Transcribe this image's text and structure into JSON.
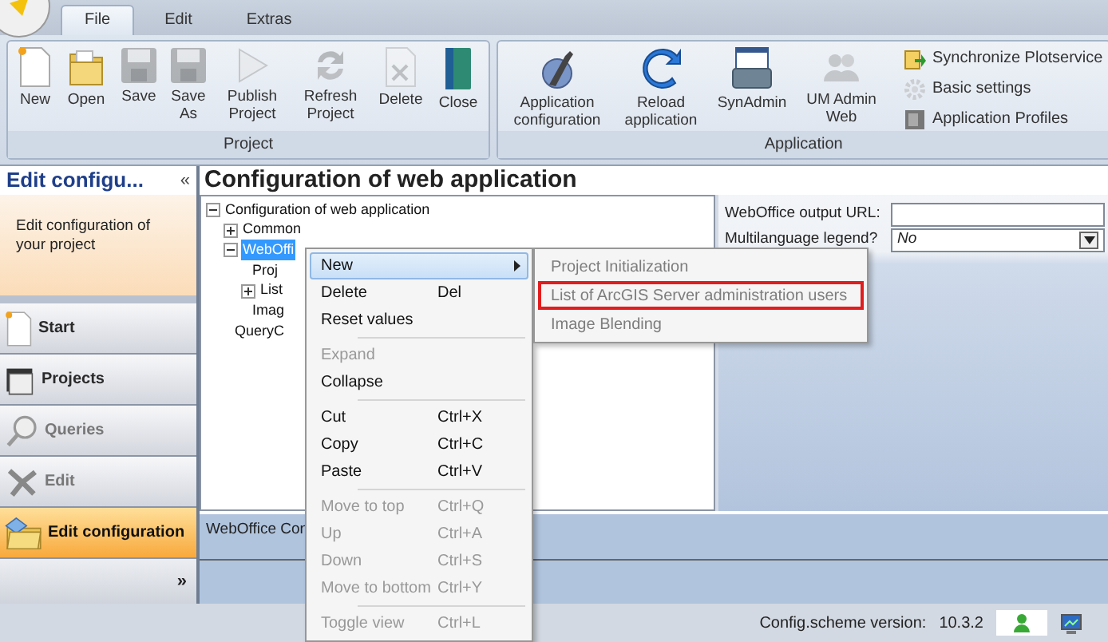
{
  "app_tabs": [
    {
      "label": "File",
      "selected": true
    },
    {
      "label": "Edit",
      "selected": false
    },
    {
      "label": "Extras",
      "selected": false
    }
  ],
  "ribbon": [
    {
      "label": "Project",
      "buttons": [
        {
          "label": "New",
          "disabled": false
        },
        {
          "label": "Open",
          "disabled": false
        },
        {
          "label": "Save",
          "disabled": true
        },
        {
          "label": "Save As",
          "disabled": true
        },
        {
          "label": "Publish Project",
          "disabled": true
        },
        {
          "label": "Refresh Project",
          "disabled": true
        },
        {
          "label": "Delete",
          "disabled": true
        },
        {
          "label": "Close",
          "disabled": false
        }
      ]
    },
    {
      "label": "Application",
      "buttons": [
        {
          "label": "Application configuration",
          "disabled": false
        },
        {
          "label": "Reload application",
          "disabled": false
        },
        {
          "label": "SynAdmin",
          "disabled": false
        },
        {
          "label": "UM Admin Web",
          "disabled": true
        }
      ],
      "small_buttons": [
        {
          "label": "Synchronize Plotservice",
          "disabled": false
        },
        {
          "label": "Basic settings",
          "disabled": true
        },
        {
          "label": "Application Profiles",
          "disabled": false
        }
      ]
    }
  ],
  "sidebar": {
    "title": "Edit  configu...",
    "collapse_glyph": "«",
    "description": "Edit configuration of your project",
    "items": [
      {
        "label": "Start",
        "disabled": false,
        "selected": false
      },
      {
        "label": "Projects",
        "disabled": false,
        "selected": false
      },
      {
        "label": "Queries",
        "disabled": true,
        "selected": false
      },
      {
        "label": "Edit",
        "disabled": true,
        "selected": false
      },
      {
        "label": "Edit configuration",
        "disabled": false,
        "selected": true
      }
    ],
    "more_glyph": "»"
  },
  "title": "Configuration of web application",
  "tree": [
    {
      "label": "Configuration of web application",
      "expanded": true,
      "selected": false,
      "children": [
        {
          "label": "Common",
          "expanded": false,
          "selected": false
        },
        {
          "label": "WebOffi",
          "expanded": true,
          "selected": true,
          "children": [
            {
              "label": "Proj",
              "selected": false
            },
            {
              "label": "List",
              "expanded": false,
              "selected": false
            },
            {
              "label": "Imag",
              "selected": false
            }
          ]
        },
        {
          "label": "QueryC",
          "selected": false
        }
      ]
    }
  ],
  "properties": [
    {
      "label": "WebOffice output URL:",
      "kind": "text"
    },
    {
      "label": "Multilanguage legend?",
      "kind": "select",
      "value": "No"
    }
  ],
  "bottom_panel": {
    "text": "WebOffice Con"
  },
  "context_menu": {
    "groups": [
      [
        {
          "label": "New",
          "has_submenu": true,
          "disabled": false,
          "selected": true
        },
        {
          "label": "Delete",
          "shortcut": "Del",
          "disabled": false,
          "selected": false
        },
        {
          "label": "Reset values",
          "disabled": false,
          "selected": false
        }
      ],
      [
        {
          "label": "Expand",
          "disabled": true,
          "selected": false
        },
        {
          "label": "Collapse",
          "disabled": false,
          "selected": false
        }
      ],
      [
        {
          "label": "Cut",
          "shortcut": "Ctrl+X",
          "disabled": false,
          "selected": false
        },
        {
          "label": "Copy",
          "shortcut": "Ctrl+C",
          "disabled": false,
          "selected": false
        },
        {
          "label": "Paste",
          "shortcut": "Ctrl+V",
          "disabled": false,
          "selected": false
        }
      ],
      [
        {
          "label": "Move to top",
          "shortcut": "Ctrl+Q",
          "disabled": true,
          "selected": false
        },
        {
          "label": "Up",
          "shortcut": "Ctrl+A",
          "disabled": true,
          "selected": false
        },
        {
          "label": "Down",
          "shortcut": "Ctrl+S",
          "disabled": true,
          "selected": false
        },
        {
          "label": "Move to bottom",
          "shortcut": "Ctrl+Y",
          "disabled": true,
          "selected": false
        }
      ],
      [
        {
          "label": "Toggle view",
          "shortcut": "Ctrl+L",
          "disabled": true,
          "selected": false
        }
      ]
    ]
  },
  "submenu": {
    "items": [
      {
        "label": "Project Initialization",
        "disabled": true,
        "highlighted": false
      },
      {
        "label": "List of ArcGIS Server administration users",
        "disabled": true,
        "highlighted": true
      },
      {
        "label": "Image Blending",
        "disabled": true,
        "highlighted": false
      }
    ]
  },
  "status_bar": {
    "label": "Config.scheme version:",
    "version": "10.3.2"
  }
}
